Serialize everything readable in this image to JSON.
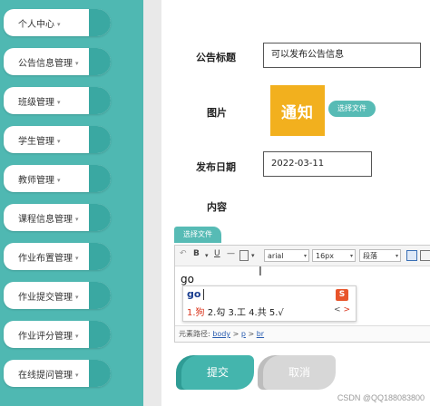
{
  "sidebar": {
    "items": [
      {
        "label": "个人中心"
      },
      {
        "label": "公告信息管理"
      },
      {
        "label": "班级管理"
      },
      {
        "label": "学生管理"
      },
      {
        "label": "教师管理"
      },
      {
        "label": "课程信息管理"
      },
      {
        "label": "作业布置管理"
      },
      {
        "label": "作业提交管理"
      },
      {
        "label": "作业评分管理"
      },
      {
        "label": "在线提问管理"
      }
    ],
    "caret": "▾"
  },
  "form": {
    "title_label": "公告标题",
    "title_value": "可以发布公告信息",
    "image_label": "图片",
    "image_text": "通知",
    "choose_file_label": "选择文件",
    "date_label": "发布日期",
    "date_value": "2022-03-11",
    "content_label": "内容",
    "content_choose_file_label": "选择文件"
  },
  "editor": {
    "toolbar": {
      "undo": "↶",
      "bold": "B",
      "underline": "U",
      "hr": "—",
      "font_family": "arial",
      "font_size": "16px",
      "paragraph": "段落"
    },
    "typed_text": "go",
    "ime": {
      "composition": "go",
      "candidates": "1.狗 2.勾 3.工 4.共 5.√",
      "first_candidate": "1.狗",
      "rest_candidates": " 2.勾 3.工 4.共 5.√",
      "logo": "S",
      "prev": "<",
      "next": ">"
    },
    "path_label": "元素路径:",
    "path_body": "body",
    "path_p": "p",
    "path_br": "br",
    "path_sep": ">"
  },
  "actions": {
    "submit_label": "提交",
    "cancel_label": "取消"
  },
  "watermark": "CSDN @QQ188083800",
  "colors": {
    "sidebar_bg": "#4fb8b2",
    "accent": "#44b5ad",
    "notice_bg": "#f2b01e"
  }
}
